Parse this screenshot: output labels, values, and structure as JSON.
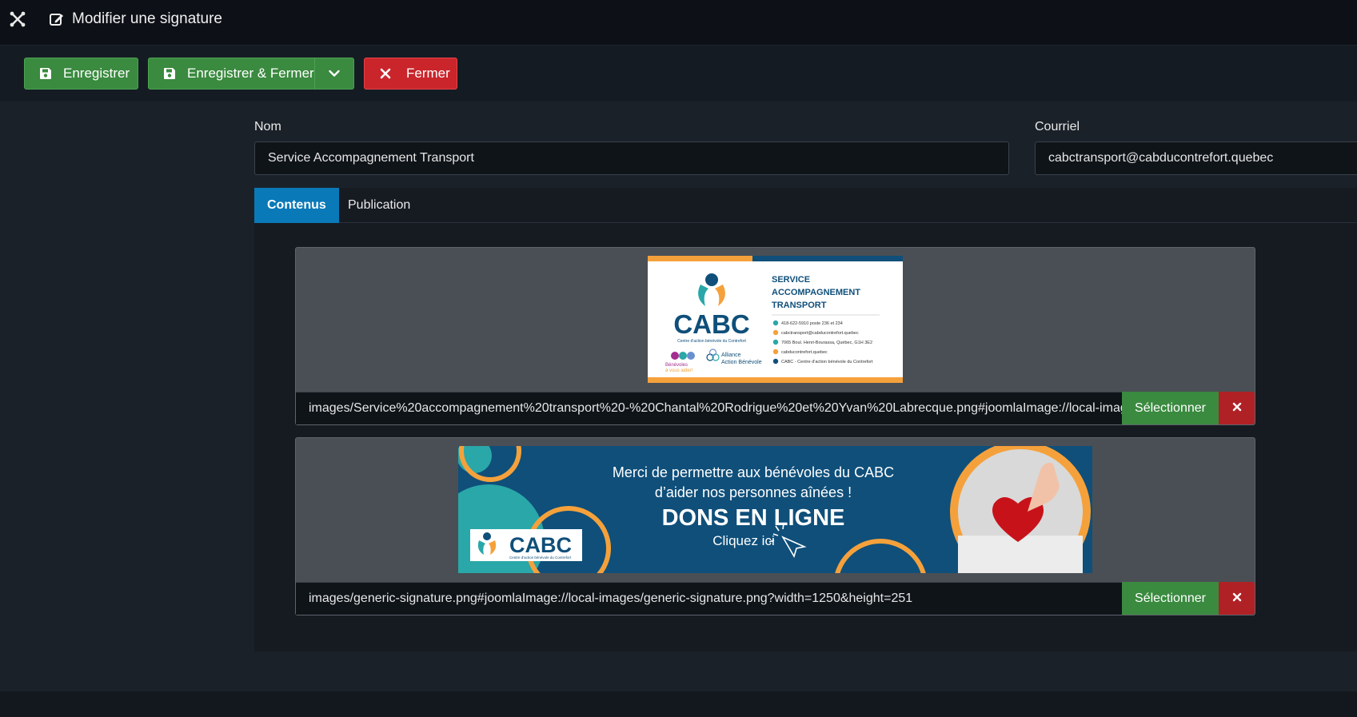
{
  "header": {
    "logo_icon": "joomla-icon",
    "title_icon": "edit-icon",
    "title": "Modifier une signature"
  },
  "toolbar": {
    "save_label": "Enregistrer",
    "save_close_label": "Enregistrer & Fermer",
    "close_label": "Fermer"
  },
  "form": {
    "name_label": "Nom",
    "name_value": "Service Accompagnement Transport",
    "email_label": "Courriel",
    "email_value": "cabctransport@cabducontrefort.quebec"
  },
  "tabs": [
    {
      "label": "Contenus",
      "active": true
    },
    {
      "label": "Publication",
      "active": false
    }
  ],
  "media": [
    {
      "path": "images/Service%20accompagnement%20transport%20-%20Chantal%20Rodrigue%20et%20Yvan%20Labrecque.png#joomlaImage://local-images/Service%20accompagnement%20transport%20-%20Chantal%20Rodrigue%20et%20Yvan%20Labrecque.png",
      "select_label": "Sélectionner",
      "image": {
        "brand": "CABC",
        "brand_sub": "Centre d'action bénévole du Contrefort",
        "service_line1": "SERVICE",
        "service_line2": "ACCOMPAGNEMENT",
        "service_line3": "TRANSPORT",
        "phone": "418-622-5910 poste 236 et 234",
        "email": "cabctransport@cabducontrefort.quebec",
        "address": "7065 Boul. Henri-Bourassa, Québec, G1H 3E2",
        "site": "cabducontrefort.quebec",
        "facebook": "CABC - Centre d'action bénévole du Contrefort",
        "help_text_1": "Bénévoles",
        "help_text_2": "à vous aider!",
        "alliance_1": "Alliance",
        "alliance_2": "Action Bénévole"
      }
    },
    {
      "path": "images/generic-signature.png#joomlaImage://local-images/generic-signature.png?width=1250&height=251",
      "select_label": "Sélectionner",
      "image": {
        "line1": "Merci de permettre aux bénévoles du CABC",
        "line2": "d’aider nos personnes aînées !",
        "line3": "DONS EN LIGNE",
        "line4": "Cliquez ici",
        "brand": "CABC",
        "brand_sub": "Centre d'action bénévole du Contrefort"
      }
    }
  ],
  "colors": {
    "accent_blue": "#0a79b8",
    "success_green": "#3a8a3f",
    "danger_red": "#c9252b",
    "cabc_orange": "#f5a13b",
    "cabc_teal": "#2aa7a8",
    "cabc_navy": "#0f4f7a"
  }
}
